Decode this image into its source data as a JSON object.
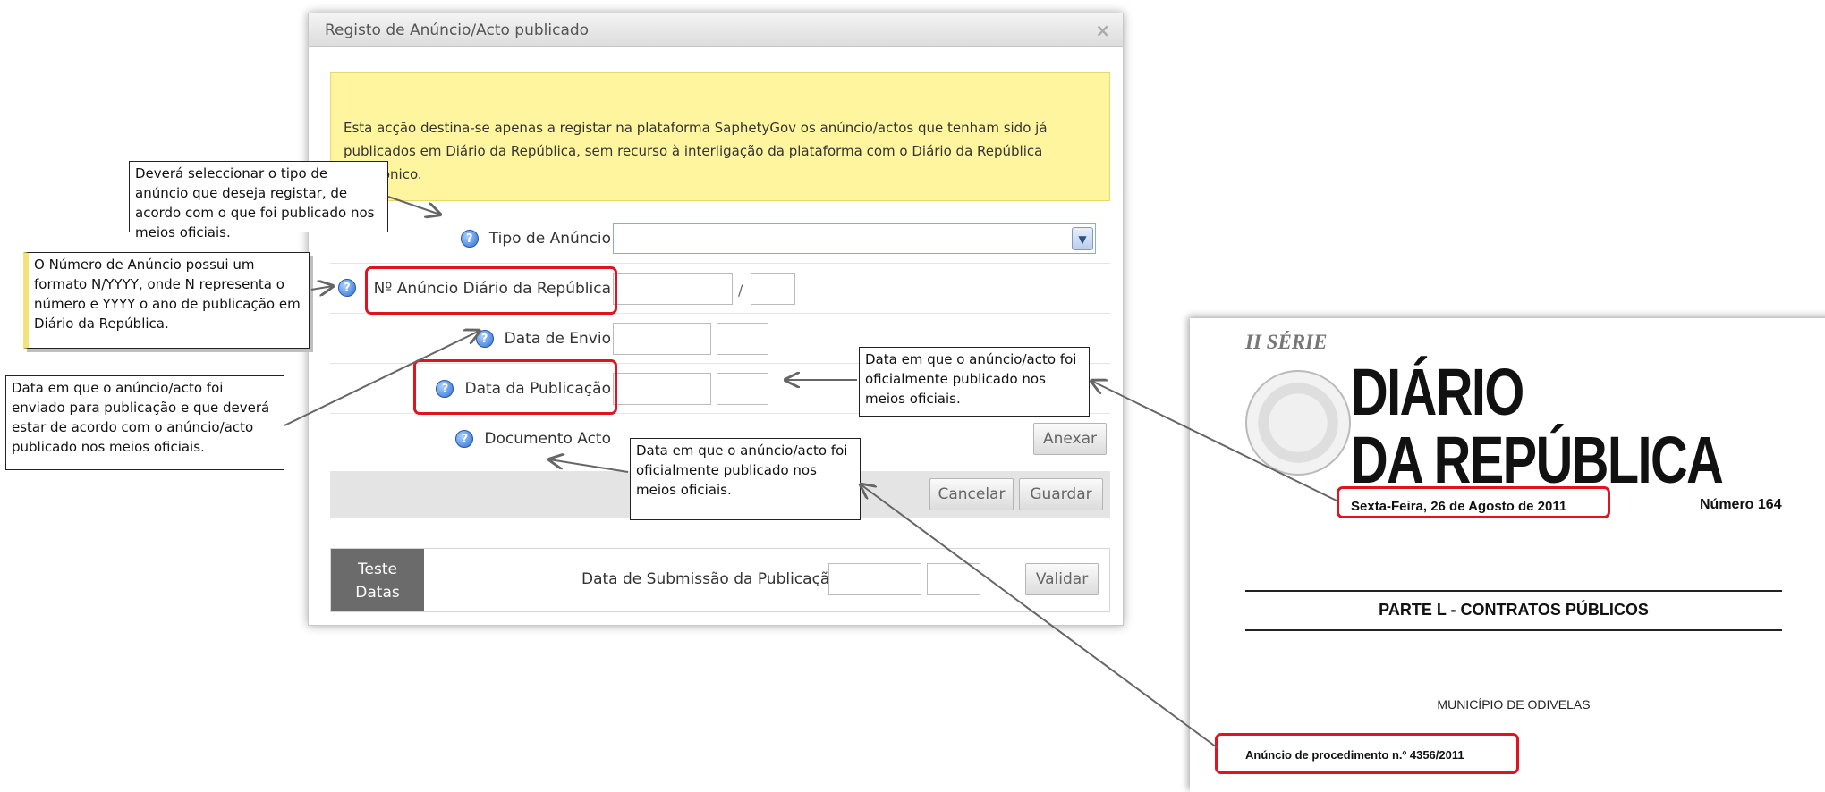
{
  "dialog": {
    "title": "Registo de Anúncio/Acto publicado",
    "close": "×",
    "notice": "Esta acção destina-se apenas a registar na plataforma SaphetyGov os anúncio/actos que tenham sido já publicados em Diário da República, sem recurso à interligação da plataforma com o Diário da República Electrónico.",
    "fields": {
      "tipo_label": "Tipo de Anúncio",
      "numero_label": "Nº Anúncio Diário da República",
      "numero_separator": "/",
      "envio_label": "Data de Envio",
      "publicacao_label": "Data da Publicação",
      "documento_label": "Documento Acto"
    },
    "buttons": {
      "anexar": "Anexar",
      "cancelar": "Cancelar",
      "guardar": "Guardar",
      "validar": "Validar"
    },
    "teste": {
      "tab_line1": "Teste",
      "tab_line2": "Datas",
      "submission_label": "Data de Submissão da Publicação:"
    },
    "help_glyph": "?"
  },
  "callouts": {
    "tipo": "Deverá seleccionar o tipo de anúncio que deseja registar, de acordo com o que foi publicado nos meios oficiais.",
    "numero": "O Número de Anúncio possui um formato N/YYYY, onde N representa o número e YYYY o ano de publicação em Diário da República.",
    "envio": "Data em que o anúncio/acto foi enviado para publicação e que deverá estar de acordo com o anúncio/acto publicado nos meios oficiais.",
    "publicacao": "Data em que o anúncio/acto foi oficialmente publicado nos meios oficiais.",
    "documento": "Data em que o anúncio/acto foi oficialmente publicado nos meios oficiais."
  },
  "newspaper": {
    "serie": "II SÉRIE",
    "masthead_line1": "DIÁRIO",
    "masthead_line2": "DA REPÚBLICA",
    "date": "Sexta-Feira, 26 de Agosto de 2011",
    "number": "Número 164",
    "parte": "PARTE L - CONTRATOS PÚBLICOS",
    "municipio": "MUNICÍPIO DE ODIVELAS",
    "anuncio": "Anúncio de procedimento n.º 4356/2011"
  },
  "colors": {
    "highlight_red": "#e0141e",
    "notice_yellow": "#fff59f",
    "tab_gray": "#6b6b6b"
  },
  "icons": [
    "help-icon",
    "dropdown-arrow-icon",
    "close-icon",
    "coat-of-arms-seal"
  ]
}
